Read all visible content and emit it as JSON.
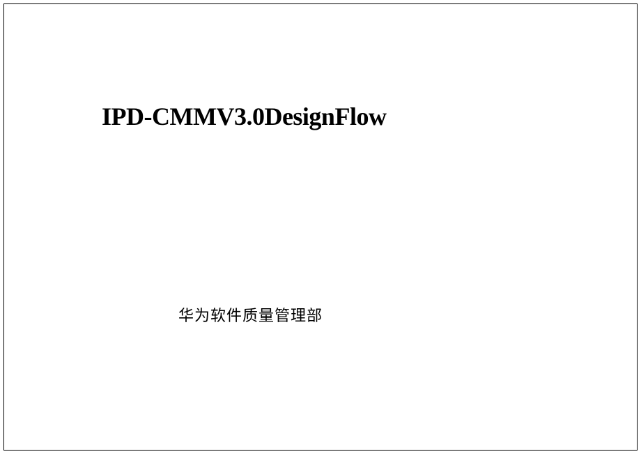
{
  "document": {
    "title": "IPD-CMMV3.0DesignFlow",
    "subtitle": "华为软件质量管理部"
  }
}
